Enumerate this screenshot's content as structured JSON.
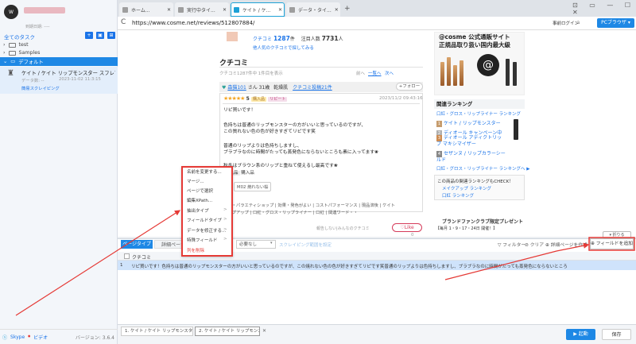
{
  "app": {
    "logo_text": "W",
    "user_sub": "到期日期: ----",
    "task_list_title": "全てのタスク",
    "sidebar_buttons": [
      "+",
      "▣",
      "⊞"
    ],
    "tree": [
      {
        "label": "test"
      },
      {
        "label": "Samples"
      }
    ],
    "group_default": "デフォルト",
    "task": {
      "title": "ケイト / ケイト リップモンスター スフレマ...",
      "meta": "データ数: --",
      "date": "2023-11-02 11:3:15",
      "mode": "簡易スクレイピング"
    },
    "footer": {
      "skype": "Skype",
      "video": "ビデオ",
      "version": "バージョン: 3.6.4"
    }
  },
  "browser": {
    "tabs": [
      {
        "label": "ホーム..."
      },
      {
        "label": "実行中タイ..."
      },
      {
        "label": "ケイト / ケ..."
      },
      {
        "label": "データ・タイ..."
      }
    ],
    "new_tab": "+",
    "window_controls": "⊡ ▭ — ☐ ✕",
    "url": "https://www.cosme.net/reviews/512807884/",
    "reload": "C",
    "login": "事前ログイン",
    "pc_mode": "PCブラウザ ▾"
  },
  "page": {
    "top_stats": {
      "kuchikomi_label": "クチコミ",
      "kuchikomi_count": "1287",
      "kuchikomi_unit": "件",
      "saved_label": "注目人数",
      "saved_count": "7731",
      "saved_unit": "人"
    },
    "top_note": "他人気のクチコミで探してみる",
    "section_title": "クチコミ",
    "section_sub": "クチコミ1287件中 1件目を表示",
    "nav_prev": "前へ",
    "nav_list": "一覧へ",
    "nav_next": "次へ",
    "reviewer": {
      "name": "森猫101",
      "age": "さん 31歳",
      "skin": "乾燥肌",
      "reviews": "クチコミ投稿21件"
    },
    "follow": "+フォロー",
    "rating": "5",
    "badge1": "購入品",
    "badge2": "リピート",
    "review_date": "2023/11/2 09:43:16",
    "review_lines": [
      "リピ買いです！",
      "",
      "色持ちは普通のリップモンスターの方がいいと思っているのですが、",
      "この質れない色の色が好きすぎてリピです笑",
      "",
      "普通のリップよりは色持ちしますし、",
      "ブラブラなのに時間がたっても蒸発色にならないところも素に入ってます❀",
      "",
      "秋冬はブラウン系のリップと重ねて使えるし最高です❀"
    ],
    "review_link_word": "ブラブラ",
    "tags_row1": [
      "購入品",
      "購入品"
    ],
    "tag_color": "M02 焼れない桜",
    "tags_row2": [
      "質感・パラエティショップ",
      "効果・発色がよい",
      "コストパフォーマンス",
      "現品済後",
      "ケイト",
      "リップアップ",
      "口紅・グロス・リップライナー",
      "口紅",
      "関連ワード・・"
    ],
    "report": "報告しない|みんなのクチコミ",
    "like": "♡Like",
    "like_count": "0"
  },
  "right": {
    "ad_title1": "@cosme 公式通販サイト",
    "ad_title2": "正規品取り扱い国内最大級",
    "rank_header": "関連ランキング",
    "rank_cat": "口紅・グロス・リップライナー ランキング",
    "rank_rows": [
      {
        "num": "1",
        "label": "ケイト / リップモンスター"
      },
      {
        "num": "2",
        "label": "ディオール キャンペーン中"
      },
      {
        "num": "3",
        "label": "ディオール アディクトリップ マキシマイザー"
      },
      {
        "num": "4",
        "label": "セザンヌ / リップカラーシールド"
      }
    ],
    "rank_link": "口紅・グロス・リップライナー ランキングへ ▶",
    "dest_title": "この商品の関連ランキングもCHECK！",
    "dest_items": [
      "メイクアップ ランキング",
      "口紅 ランキング"
    ],
    "brand_title": "ブランドファンクラブ限定プレゼント",
    "brand_sub": "【毎月 1・9・17・24日 開催！】"
  },
  "panel": {
    "tab_type": "ページタイプ",
    "tab_detail": "詳細ページ",
    "select_value": "必要なし",
    "expand_hint": "スクレイピング範囲を設定",
    "tools": [
      "▽ フィルター",
      "⊘ クリア",
      "⊕ 詳細ページを作成"
    ],
    "collapse": "▾ 折りる",
    "add_field": "⊕ フィールドを追加",
    "grid_header": "クチコミ",
    "row_num": "1",
    "row_text": "リピ買いです！色持ちは普通のリップモンスターの方がいいと思っているのですが、この焼れない色の色が好きすぎてリピです笑普通のリップよりは色持ちしますし、ブラブラなのに時間がたっても蒸発色にならないところ"
  },
  "bottom": {
    "tabs": [
      "1. ケイト / ケイト リップモンスタ...",
      "2. ケイト / ケイト リップモンスタ..."
    ],
    "close": "✕",
    "start": "▶ 起動",
    "save": "保存"
  },
  "context_menu": {
    "items": [
      {
        "label": "名前を変更する...",
        "arrow": ""
      },
      {
        "label": "マージ...",
        "arrow": ""
      },
      {
        "label": "ページで選択",
        "arrow": ""
      },
      {
        "label": "編集XPath...",
        "arrow": ""
      },
      {
        "label": "抽出タイプ",
        "arrow": ">"
      },
      {
        "label": "フィールドタイプ",
        "arrow": ">"
      },
      {
        "label": "データを修正する...",
        "arrow": ">"
      },
      {
        "label": "特殊フィールド",
        "arrow": ">"
      },
      {
        "label": "列を削除",
        "arrow": ""
      }
    ]
  },
  "colors": {
    "accent": "#1e88e5",
    "annotation": "#e53935",
    "selected_row": "#cfe3fb"
  }
}
